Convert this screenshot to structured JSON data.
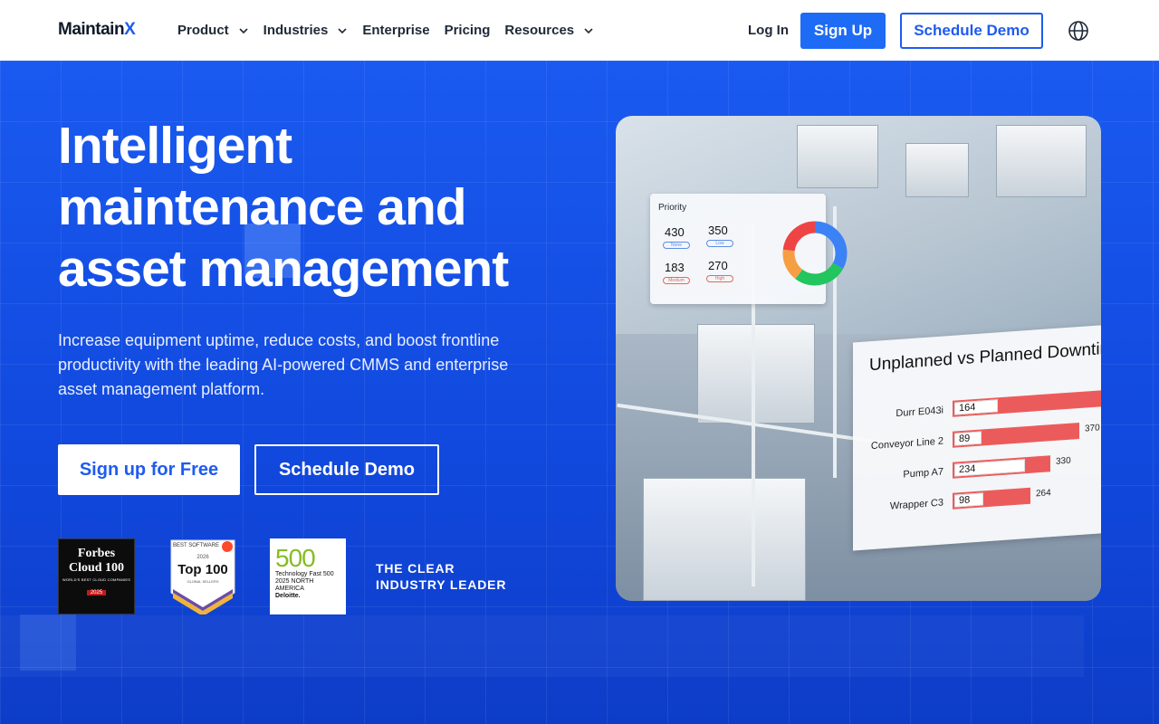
{
  "nav": {
    "logo_main": "Maintain",
    "logo_x": "X",
    "items": [
      {
        "label": "Product",
        "dropdown": true
      },
      {
        "label": "Industries",
        "dropdown": true
      },
      {
        "label": "Enterprise",
        "dropdown": false
      },
      {
        "label": "Pricing",
        "dropdown": false
      },
      {
        "label": "Resources",
        "dropdown": true
      }
    ],
    "login": "Log In",
    "signup": "Sign Up",
    "demo": "Schedule Demo"
  },
  "hero": {
    "headline": "Intelligent maintenance and asset management",
    "subtext": "Increase equipment uptime, reduce costs, and boost frontline productivity with the leading AI-powered CMMS and enterprise asset management platform.",
    "cta_primary": "Sign up for Free",
    "cta_secondary": "Schedule Demo",
    "leader_line1": "THE CLEAR",
    "leader_line2": "INDUSTRY LEADER"
  },
  "badges": {
    "forbes": {
      "brand": "Forbes",
      "title": "Cloud 100",
      "sub": "WORLD'S BEST CLOUD COMPANIES",
      "year": "2025"
    },
    "g2": {
      "top": "BEST SOFTWARE",
      "year": "2026",
      "title": "Top 100",
      "sub": "GLOBAL SELLERS"
    },
    "deloitte": {
      "number": "500",
      "line1": "Technology Fast 500",
      "line2": "2025 NORTH AMERICA",
      "brand": "Deloitte."
    }
  },
  "priority_card": {
    "title": "Priority",
    "items": [
      {
        "value": "430",
        "label": "None"
      },
      {
        "value": "350",
        "label": "Low"
      },
      {
        "value": "183",
        "label": "Medium"
      },
      {
        "value": "270",
        "label": "High"
      }
    ]
  },
  "downtime_card": {
    "title": "Unplanned vs Planned Downtim",
    "rows": [
      {
        "label": "Durr E043i",
        "inner": "164",
        "outer": ""
      },
      {
        "label": "Conveyor Line 2",
        "inner": "89",
        "outer": "370"
      },
      {
        "label": "Pump A7",
        "inner": "234",
        "outer": "330"
      },
      {
        "label": "Wrapper C3",
        "inner": "98",
        "outer": "264"
      }
    ]
  },
  "colors": {
    "brand_blue": "#1e5bf0",
    "hero_blue": "#1350e8",
    "bar_red": "#ec5b5b"
  }
}
